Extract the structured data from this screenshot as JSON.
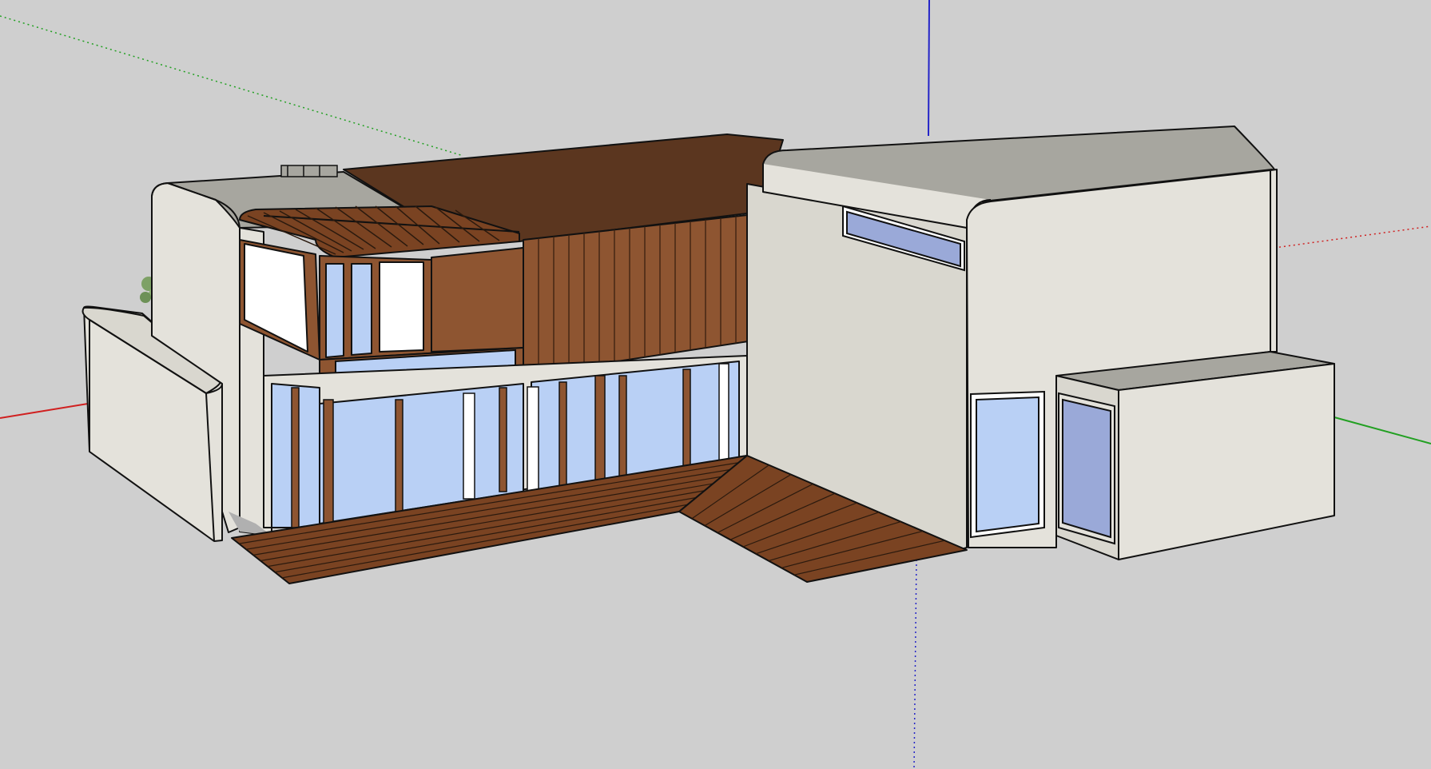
{
  "viewport": {
    "background_color": "#cfcfcf",
    "axes": {
      "red_axis_color": "#d02020",
      "green_axis_color": "#22a022",
      "blue_axis_color": "#2424c8"
    }
  },
  "model": {
    "wall_color": "#e4e2db",
    "wall_shadow_color": "#d2d0c8",
    "roof_gray_color": "#a7a69f",
    "roof_wood_color": "#5b361f",
    "cladding_wood_color": "#8e5531",
    "deck_wood_color": "#7a4322",
    "glass_color": "#b9d0f5",
    "glass_dark_color": "#9aa9d8",
    "outline_color": "#111111",
    "tree_color": "#7ea166"
  }
}
